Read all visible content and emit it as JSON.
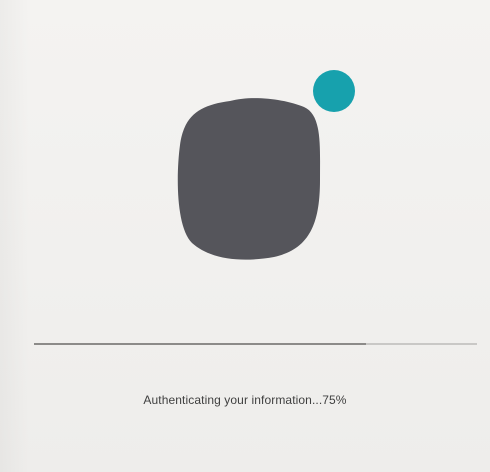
{
  "status": {
    "message": "Authenticating your information...75%",
    "progress_fraction": 0.75
  },
  "logo": {
    "blob_icon": "rounded-blob-icon",
    "dot_icon": "teal-dot-icon"
  },
  "colors": {
    "background": "#f2f1ef",
    "blob": "#55555b",
    "dot": "#17a1ad",
    "progress_track": "#c9c8c6",
    "progress_fill": "#8c8b89",
    "text": "#3f3f3f"
  }
}
